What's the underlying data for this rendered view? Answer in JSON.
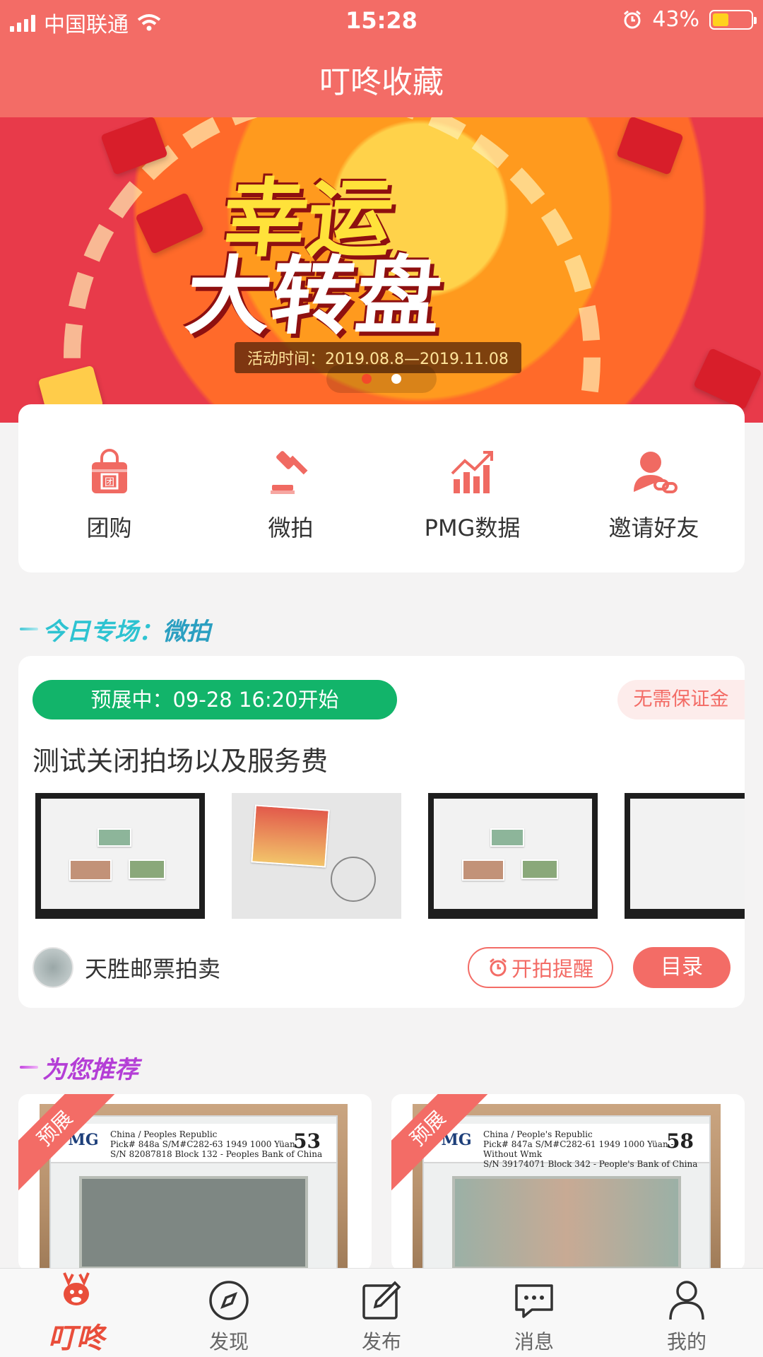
{
  "status": {
    "carrier": "中国联通",
    "time": "15:28",
    "battery": "43%",
    "battery_level": 0.43
  },
  "nav": {
    "title": "叮咚收藏"
  },
  "banner": {
    "headline_line1": "幸运",
    "headline_line2": "大转盘",
    "period": "活动时间：2019.08.8—2019.11.08",
    "page_count": 2,
    "active_index": 0
  },
  "quick_menu": [
    {
      "label": "团购",
      "icon": "group-buy-bag-icon"
    },
    {
      "label": "微拍",
      "icon": "auction-gavel-icon"
    },
    {
      "label": "PMG数据",
      "icon": "chart-trend-icon"
    },
    {
      "label": "邀请好友",
      "icon": "invite-friend-icon"
    }
  ],
  "today_section": {
    "title": "今日专场：",
    "highlight": "微拍"
  },
  "auction": {
    "status": "预展中：09-28 16:20开始",
    "deposit_badge": "无需保证金",
    "title": "测试关闭拍场以及服务费",
    "seller": "天胜邮票拍卖",
    "remind_button": "开拍提醒",
    "catalog_button": "目录"
  },
  "recommend_section": {
    "title": "为您推荐"
  },
  "recommend": [
    {
      "badge": "预展",
      "logo": "PMG",
      "line1": "China / Peoples Republic",
      "line2": "Pick# 848a  S/M#C282-63  1949 1000 Yüan",
      "line3": "S/N 82087818 Block 132 - Peoples Bank of China",
      "grade": "53"
    },
    {
      "badge": "预展",
      "logo": "PMG",
      "line1": "China / People's Republic",
      "line2": "Pick# 847a  S/M#C282-61  1949 1000 Yüan - Without Wmk",
      "line3": "S/N 39174071 Block 342 - People's Bank of China",
      "grade": "58"
    }
  ],
  "tabbar": [
    {
      "label": "叮咚",
      "icon": "home-deer-logo-icon"
    },
    {
      "label": "发现",
      "icon": "compass-icon"
    },
    {
      "label": "发布",
      "icon": "edit-icon"
    },
    {
      "label": "消息",
      "icon": "message-bubble-icon"
    },
    {
      "label": "我的",
      "icon": "user-icon"
    }
  ],
  "colors": {
    "brand": "#f36c66",
    "green": "#12b46a",
    "background": "#f4f3f3"
  }
}
